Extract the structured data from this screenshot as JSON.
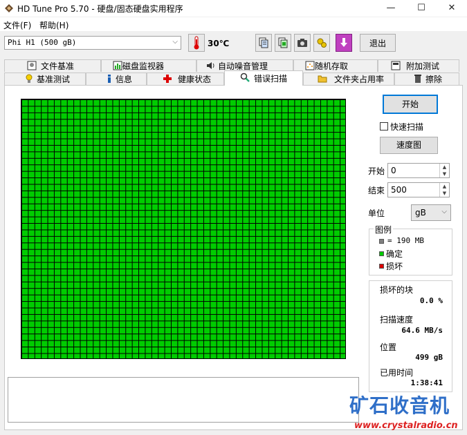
{
  "window": {
    "title": "HD Tune Pro 5.70 - 硬盘/固态硬盘实用程序",
    "minimize": "—",
    "maximize": "☐",
    "close": "✕"
  },
  "menu": {
    "items": [
      "文件(F)",
      "帮助(H)"
    ]
  },
  "toolbar": {
    "drive": "Phi     H1 (500 gB)",
    "temperature": "30℃",
    "exit_label": "退出",
    "icons": [
      "copy-text-icon",
      "copy-info-icon",
      "screenshot-icon",
      "options-icon",
      "save-down-icon"
    ]
  },
  "tabs": {
    "row1": [
      {
        "label": "文件基准",
        "icon": "file-benchmark-icon"
      },
      {
        "label": "磁盘监视器",
        "icon": "disk-monitor-icon"
      },
      {
        "label": "自动噪音管理",
        "icon": "speaker-icon"
      },
      {
        "label": "随机存取",
        "icon": "random-access-icon"
      },
      {
        "label": "附加测试",
        "icon": "extra-tests-icon"
      }
    ],
    "row2": [
      {
        "label": "基准测试",
        "icon": "benchmark-icon"
      },
      {
        "label": "信息",
        "icon": "info-icon"
      },
      {
        "label": "健康状态",
        "icon": "health-icon"
      },
      {
        "label": "错误扫描",
        "icon": "magnifier-icon",
        "active": true
      },
      {
        "label": "文件夹占用率",
        "icon": "folder-icon"
      },
      {
        "label": "擦除",
        "icon": "trash-icon"
      }
    ]
  },
  "scan": {
    "start_button": "开始",
    "quick_scan_label": "快速扫描",
    "quick_scan_checked": false,
    "speed_map_button": "速度图",
    "start_label": "开始",
    "start_value": "0",
    "end_label": "结束",
    "end_value": "500",
    "unit_label": "单位",
    "unit_value": "gB",
    "block_status": "all-ok",
    "block_ok_color": "#00cc00"
  },
  "legend": {
    "title": "图例",
    "block_size": "= 190 MB",
    "ok_label": "确定",
    "bad_label": "损坏",
    "block_color": "#808080",
    "ok_color": "#00cc00",
    "bad_color": "#dd0000"
  },
  "stats": {
    "damaged_label": "损坏的块",
    "damaged_value": "0.0 %",
    "speed_label": "扫描速度",
    "speed_value": "64.6 MB/s",
    "position_label": "位置",
    "position_value": "499 gB",
    "elapsed_label": "已用时间",
    "elapsed_value": "1:38:41"
  },
  "watermark": {
    "name": "矿石收音机",
    "url": "www.crystalradio.cn"
  }
}
